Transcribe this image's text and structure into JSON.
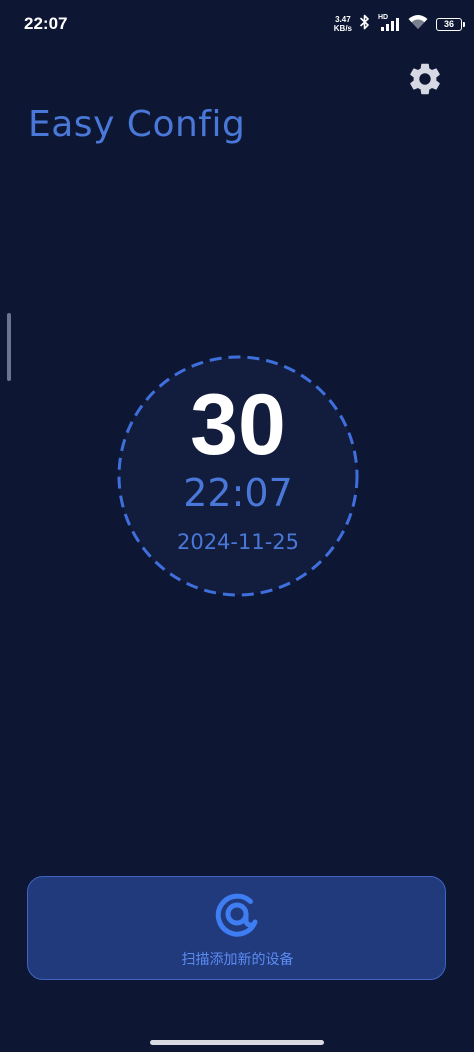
{
  "status_bar": {
    "time": "22:07",
    "net_speed_value": "3.47",
    "net_speed_unit": "KB/s",
    "hd_label": "HD",
    "battery_level": "36",
    "icons": [
      "bluetooth-icon",
      "signal-icon",
      "wifi-icon",
      "battery-icon"
    ]
  },
  "header": {
    "title": "Easy Config",
    "settings_icon": "gear-icon"
  },
  "clock": {
    "count": "30",
    "time": "22:07",
    "date": "2024-11-25"
  },
  "scan_button": {
    "icon": "scan-at-icon",
    "label": "扫描添加新的设备"
  },
  "colors": {
    "background": "#0d1733",
    "accent": "#4a78d8",
    "button_bg": "#213a7c",
    "button_border": "#3f63c4",
    "button_text": "#5c8bf2"
  }
}
